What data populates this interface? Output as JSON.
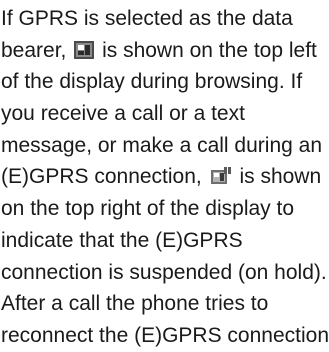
{
  "paragraph": {
    "line1": "If GPRS is selected as the data",
    "line2_before_icon": "bearer,",
    "line2_after_icon": "is shown on the top left",
    "line3": "of the display during browsing. If",
    "line4": "you receive a call or a text",
    "line5": "message, or make a call during an",
    "line6_before_icon": "(E)GPRS connection,",
    "line6_after_icon": "is shown",
    "line7": "on the top right of the display to",
    "line8": "indicate that the (E)GPRS",
    "line9": "connection is suspended (on hold).",
    "line10": "After a call the phone tries to",
    "line11": "reconnect the (E)GPRS connection."
  },
  "icons": {
    "gprs_active": "gprs-active-icon",
    "gprs_suspended": "gprs-suspended-icon"
  }
}
